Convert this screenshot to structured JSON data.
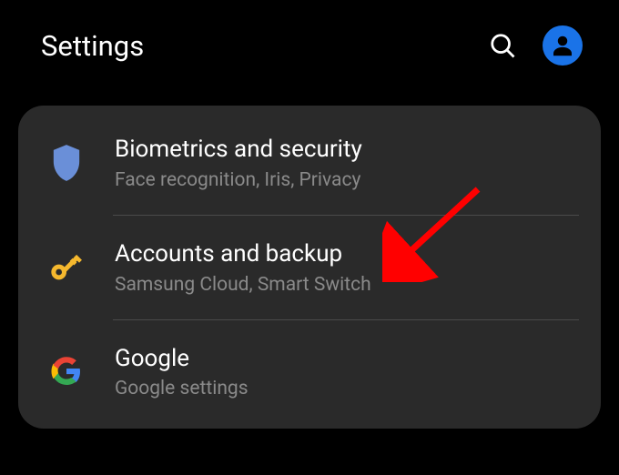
{
  "header": {
    "title": "Settings"
  },
  "items": [
    {
      "title": "Biometrics and security",
      "subtitle": "Face recognition, Iris, Privacy"
    },
    {
      "title": "Accounts and backup",
      "subtitle": "Samsung Cloud, Smart Switch"
    },
    {
      "title": "Google",
      "subtitle": "Google settings"
    }
  ]
}
